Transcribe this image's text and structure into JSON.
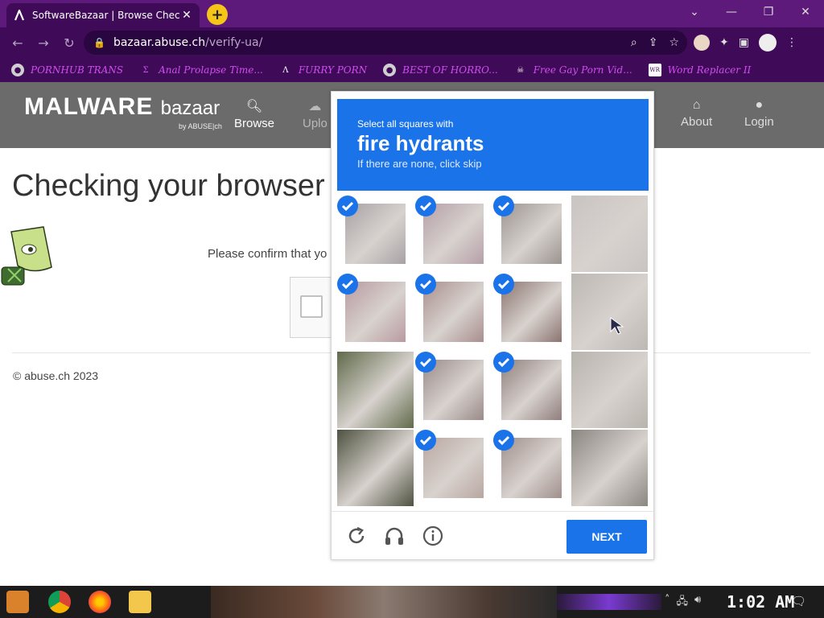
{
  "browser": {
    "tab_title": "SoftwareBazaar | Browse Chec",
    "tab_close": "✕",
    "new_tab": "+",
    "url_host": "bazaar.abuse.ch",
    "url_path": "/verify-ua/",
    "bookmarks": [
      {
        "label": "PORNHUB TRANS",
        "icon": "globe-icon"
      },
      {
        "label": "Anal Prolapse Time...",
        "icon": "sigma-icon"
      },
      {
        "label": "FURRY PORN",
        "icon": "lambda-icon"
      },
      {
        "label": "BEST OF HORRO...",
        "icon": "globe-icon"
      },
      {
        "label": "Free Gay Porn Vid...",
        "icon": "skull-icon"
      },
      {
        "label": "Word Replacer II",
        "icon": "wr-icon"
      }
    ]
  },
  "site": {
    "logo_main": "MALWARE",
    "logo_sub": "bazaar",
    "logo_by": "by ABUSE|ch",
    "nav": {
      "browse": "Browse",
      "upload": "Uplo",
      "about": "About",
      "login": "Login"
    },
    "title": "Checking your browser",
    "confirm_text": "Please confirm that yo",
    "copyright": "© abuse.ch 2023"
  },
  "challenge": {
    "prompt": "Select all squares with",
    "target": "fire hydrants",
    "sub": "If there are none, click skip",
    "next_label": "NEXT",
    "grid": [
      [
        true,
        true,
        true,
        false
      ],
      [
        true,
        true,
        true,
        false
      ],
      [
        false,
        true,
        true,
        false
      ],
      [
        false,
        true,
        true,
        false
      ]
    ]
  },
  "taskbar": {
    "clock": "1:02 AM"
  },
  "colors": {
    "chrome_purple": "#5e1a7a",
    "bookmark_text": "#d14df2",
    "captcha_blue": "#1a73e8",
    "site_header": "#6b6b6b"
  }
}
